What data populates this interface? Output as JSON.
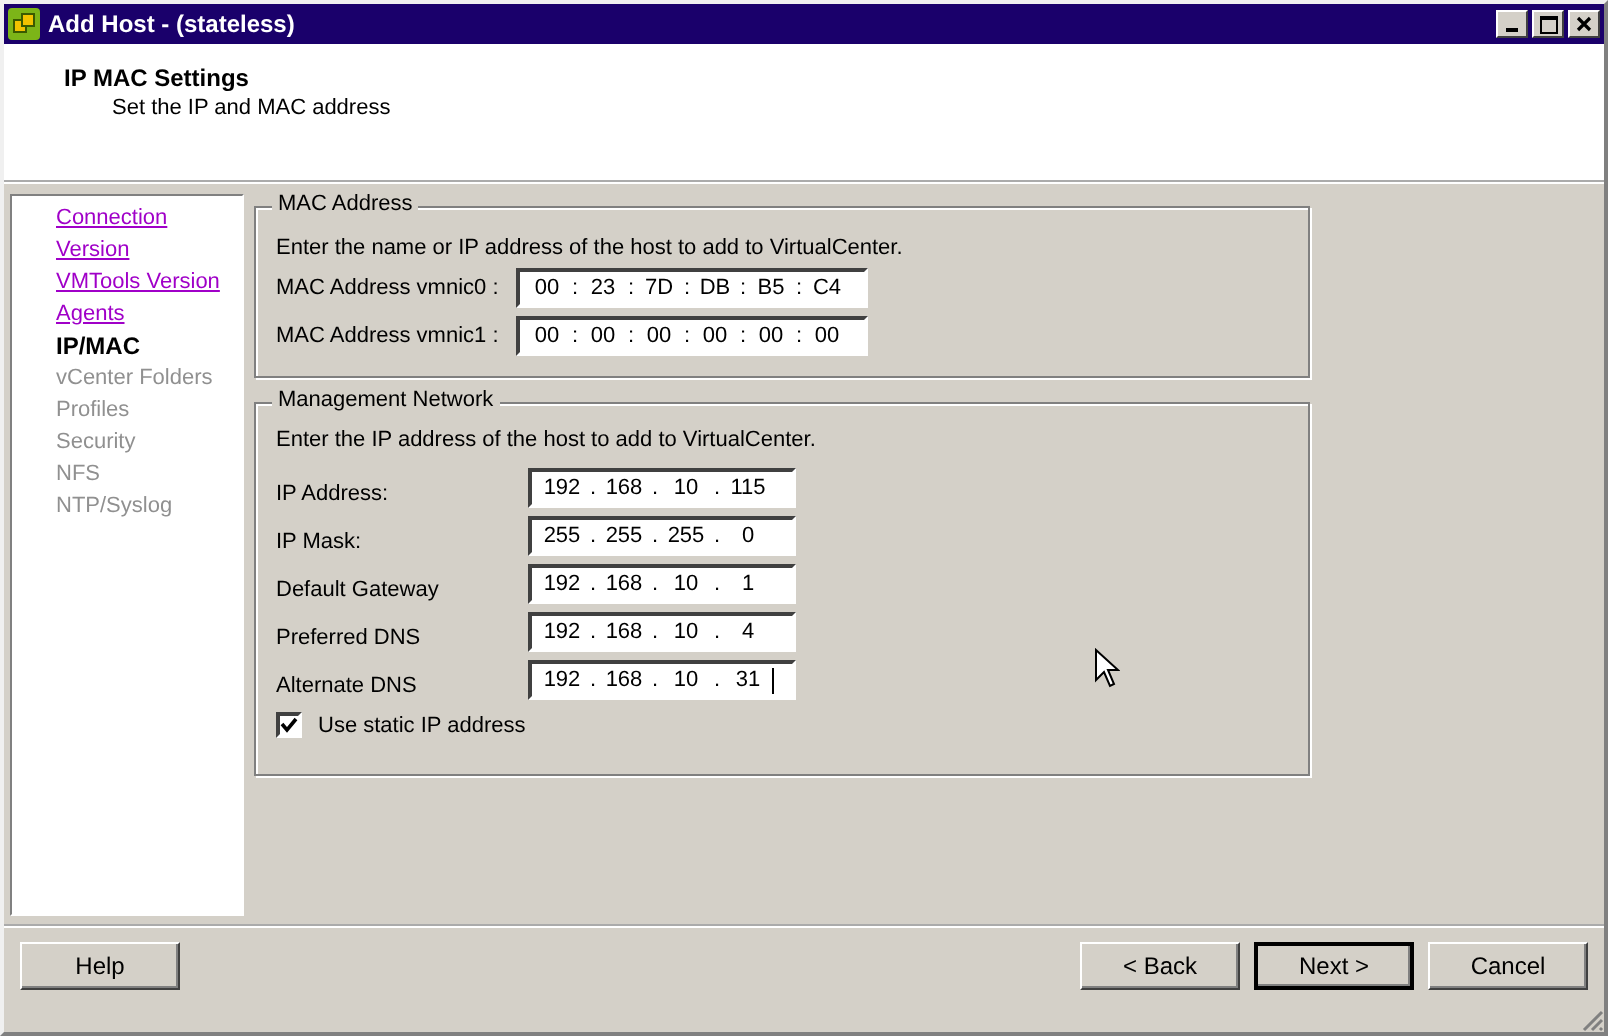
{
  "window": {
    "title": "Add Host - (stateless)"
  },
  "header": {
    "title": "IP  MAC Settings",
    "subtitle": "Set the IP and MAC address"
  },
  "sidebar": {
    "items": [
      {
        "label": "Connection",
        "kind": "link"
      },
      {
        "label": "Version",
        "kind": "link"
      },
      {
        "label": "VMTools Version",
        "kind": "link"
      },
      {
        "label": "Agents",
        "kind": "link"
      },
      {
        "label": "IP/MAC",
        "kind": "current"
      },
      {
        "label": "vCenter Folders",
        "kind": "pending"
      },
      {
        "label": "Profiles",
        "kind": "pending"
      },
      {
        "label": "Security",
        "kind": "pending"
      },
      {
        "label": "NFS",
        "kind": "pending"
      },
      {
        "label": "NTP/Syslog",
        "kind": "pending"
      }
    ]
  },
  "mac_group": {
    "title": "MAC Address",
    "separator": ":",
    "description": "Enter the name or IP address of the host to add to VirtualCenter.",
    "fields": [
      {
        "label": "MAC Address vmnic0 :",
        "parts": [
          "00",
          "23",
          "7D",
          "DB",
          "B5",
          "C4"
        ]
      },
      {
        "label": "MAC Address vmnic1 :",
        "parts": [
          "00",
          "00",
          "00",
          "00",
          "00",
          "00"
        ]
      }
    ]
  },
  "network_group": {
    "title": "Management Network",
    "separator": ".",
    "description": "Enter the IP address of the host to add to VirtualCenter.",
    "fields": [
      {
        "label": "IP Address:",
        "parts": [
          "192",
          "168",
          "10",
          "115"
        ],
        "focused": false
      },
      {
        "label": "IP Mask:",
        "parts": [
          "255",
          "255",
          "255",
          "0"
        ],
        "focused": false
      },
      {
        "label": "Default Gateway",
        "parts": [
          "192",
          "168",
          "10",
          "1"
        ],
        "focused": false
      },
      {
        "label": "Preferred DNS",
        "parts": [
          "192",
          "168",
          "10",
          "4"
        ],
        "focused": false
      },
      {
        "label": "Alternate DNS",
        "parts": [
          "192",
          "168",
          "10",
          "31"
        ],
        "focused": true
      }
    ],
    "static_ip": {
      "label": "Use static IP address",
      "checked": true
    }
  },
  "buttons": [
    {
      "label": "Help",
      "default": false
    },
    {
      "label": "< Back",
      "default": false
    },
    {
      "label": "Next >",
      "default": true
    },
    {
      "label": "Cancel",
      "default": false
    }
  ]
}
